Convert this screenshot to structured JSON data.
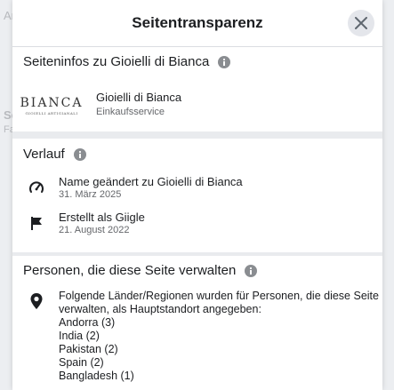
{
  "backdrop": {
    "fragments": [
      "An",
      "Se",
      "Fa"
    ]
  },
  "dialog": {
    "title": "Seitentransparenz",
    "close_icon": "close-icon"
  },
  "page_info": {
    "heading": "Seiteninfos zu Gioielli di Bianca",
    "logo_text": "BIANCA",
    "logo_subtext": "GIOIELLI ARTIGIANALI",
    "page_name": "Gioielli di Bianca",
    "category": "Einkaufsservice"
  },
  "history": {
    "heading": "Verlauf",
    "items": [
      {
        "icon": "name-change-icon",
        "title": "Name geändert zu Gioielli di Bianca",
        "date": "31. März 2025"
      },
      {
        "icon": "flag-icon",
        "title": "Erstellt als Giigle",
        "date": "21. August 2022"
      }
    ]
  },
  "managers": {
    "heading": "Personen, die diese Seite verwalten",
    "intro_line1": "Folgende Länder/Regionen wurden für Personen, die diese Seite",
    "intro_line2": "verwalten, als Hauptstandort angegeben:",
    "countries": [
      "Andorra (3)",
      "India (2)",
      "Pakistan (2)",
      "Spain (2)",
      "Bangladesh (1)"
    ]
  }
}
